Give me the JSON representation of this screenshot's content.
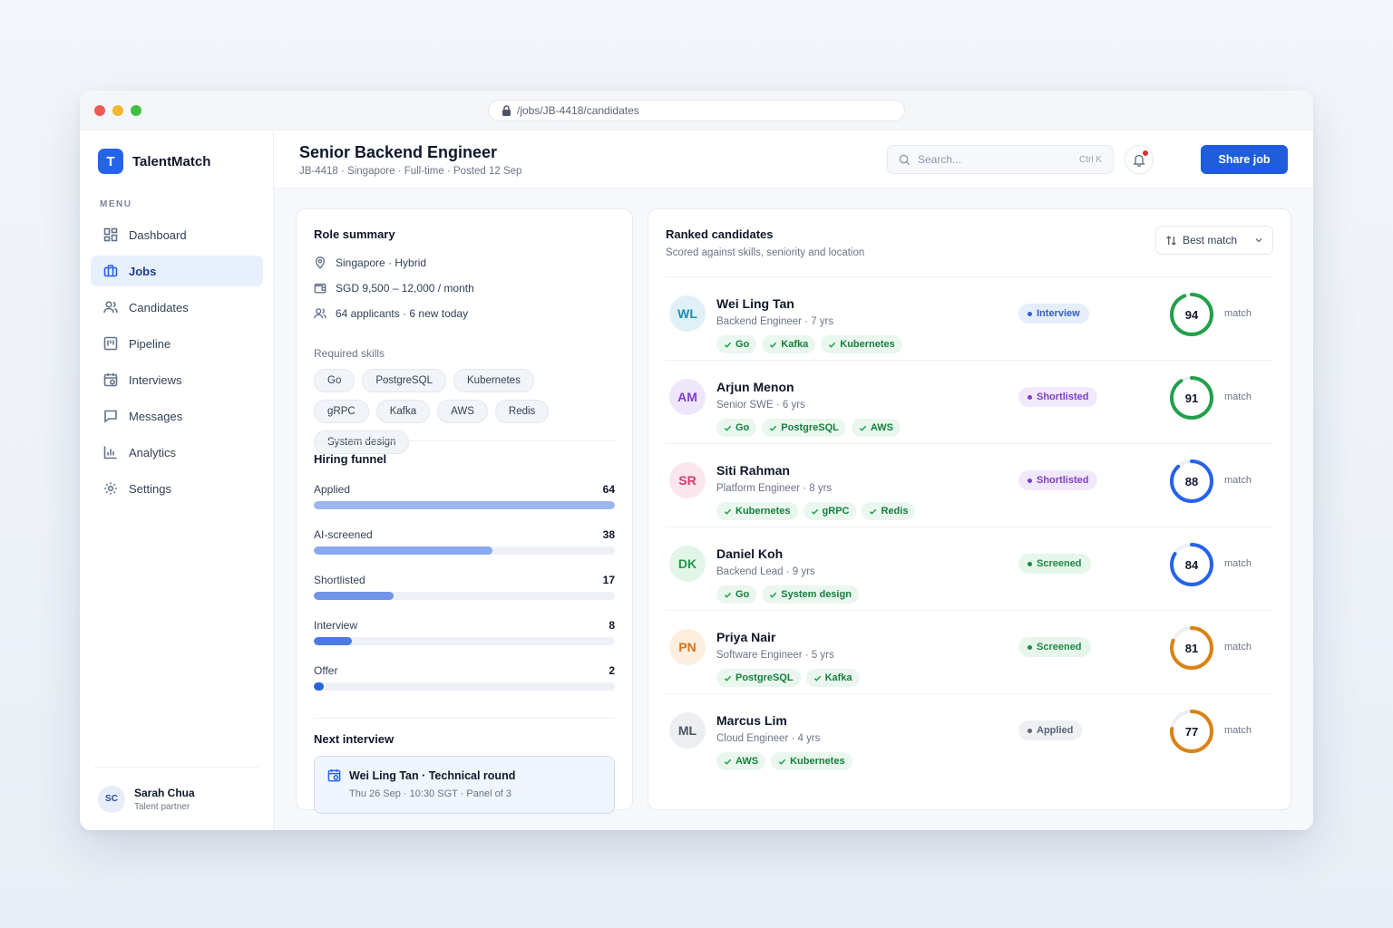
{
  "browser": {
    "url": "/jobs/JB-4418/candidates"
  },
  "brand": {
    "logo_letter": "T",
    "name": "TalentMatch",
    "color": "#2563eb"
  },
  "sidebar": {
    "menu_label": "MENU",
    "items": [
      {
        "label": "Dashboard",
        "icon": "dashboard-icon",
        "active": false
      },
      {
        "label": "Jobs",
        "icon": "briefcase-icon",
        "active": true
      },
      {
        "label": "Candidates",
        "icon": "users-icon",
        "active": false
      },
      {
        "label": "Pipeline",
        "icon": "kanban-icon",
        "active": false
      },
      {
        "label": "Interviews",
        "icon": "calendar-icon",
        "active": false
      },
      {
        "label": "Messages",
        "icon": "chat-icon",
        "active": false
      },
      {
        "label": "Analytics",
        "icon": "bar-chart-icon",
        "active": false
      },
      {
        "label": "Settings",
        "icon": "gear-icon",
        "active": false
      }
    ],
    "user": {
      "initials": "SC",
      "name": "Sarah Chua",
      "role": "Talent partner"
    }
  },
  "header": {
    "title": "Senior Backend Engineer",
    "subtitle": "JB-4418 · Singapore · Full-time · Posted 12 Sep",
    "search_placeholder": "Search...",
    "search_shortcut": "Ctrl K",
    "share_label": "Share job"
  },
  "role_summary": {
    "title": "Role summary",
    "location": "Singapore · Hybrid",
    "salary": "SGD 9,500 – 12,000 / month",
    "applicants": "64 applicants · 6 new today",
    "skills_label": "Required skills",
    "skills": [
      "Go",
      "PostgreSQL",
      "Kubernetes",
      "gRPC",
      "Kafka",
      "AWS",
      "Redis",
      "System design"
    ]
  },
  "funnel": {
    "title": "Hiring funnel",
    "stages": [
      {
        "label": "Applied",
        "count": "64",
        "value": 64,
        "color": "#9db7ee"
      },
      {
        "label": "AI-screened",
        "count": "38",
        "value": 38,
        "color": "#8aa9ec"
      },
      {
        "label": "Shortlisted",
        "count": "17",
        "value": 17,
        "color": "#6f94e8"
      },
      {
        "label": "Interview",
        "count": "8",
        "value": 8,
        "color": "#4b7be3"
      },
      {
        "label": "Offer",
        "count": "2",
        "value": 2,
        "color": "#2a63dc"
      }
    ],
    "max": 64
  },
  "next_interview": {
    "title": "Next interview",
    "heading": "Wei Ling Tan · Technical round",
    "detail": "Thu 26 Sep · 10:30 SGT · Panel of 3"
  },
  "ranked": {
    "title": "Ranked candidates",
    "subtitle": "Scored against skills, seniority and location",
    "sort_label": "Best match",
    "match_label": "match",
    "candidates": [
      {
        "initials": "WL",
        "name": "Wei Ling Tan",
        "role": "Backend Engineer · 7 yrs",
        "skills": [
          "Go",
          "Kafka",
          "Kubernetes"
        ],
        "status": "Interview",
        "score": 94,
        "avatar_bg": "#dff1f7",
        "avatar_fg": "#1a8fb3",
        "status_bg": "#e6eefc",
        "status_fg": "#2e5ec9",
        "ring": "#22a04b"
      },
      {
        "initials": "AM",
        "name": "Arjun Menon",
        "role": "Senior SWE · 6 yrs",
        "skills": [
          "Go",
          "PostgreSQL",
          "AWS"
        ],
        "status": "Shortlisted",
        "score": 91,
        "avatar_bg": "#efe6fb",
        "avatar_fg": "#7b3fc9",
        "status_bg": "#f2e8fc",
        "status_fg": "#7e3fc6",
        "ring": "#22a04b"
      },
      {
        "initials": "SR",
        "name": "Siti Rahman",
        "role": "Platform Engineer · 8 yrs",
        "skills": [
          "Kubernetes",
          "gRPC",
          "Redis"
        ],
        "status": "Shortlisted",
        "score": 88,
        "avatar_bg": "#fbe6ee",
        "avatar_fg": "#d0396e",
        "status_bg": "#f2e8fc",
        "status_fg": "#7e3fc6",
        "ring": "#2563eb"
      },
      {
        "initials": "DK",
        "name": "Daniel Koh",
        "role": "Backend Lead · 9 yrs",
        "skills": [
          "Go",
          "System design"
        ],
        "status": "Screened",
        "score": 84,
        "avatar_bg": "#e3f5e8",
        "avatar_fg": "#1f9a4a",
        "status_bg": "#e6f6ea",
        "status_fg": "#1f8a44",
        "ring": "#2563eb"
      },
      {
        "initials": "PN",
        "name": "Priya Nair",
        "role": "Software Engineer · 5 yrs",
        "skills": [
          "PostgreSQL",
          "Kafka"
        ],
        "status": "Screened",
        "score": 81,
        "avatar_bg": "#fdeede",
        "avatar_fg": "#d9731a",
        "status_bg": "#e6f6ea",
        "status_fg": "#1f8a44",
        "ring": "#d98316"
      },
      {
        "initials": "ML",
        "name": "Marcus Lim",
        "role": "Cloud Engineer · 4 yrs",
        "skills": [
          "AWS",
          "Kubernetes"
        ],
        "status": "Applied",
        "score": 77,
        "avatar_bg": "#eceef2",
        "avatar_fg": "#4b5565",
        "status_bg": "#eef0f3",
        "status_fg": "#5b6577",
        "ring": "#d98316"
      }
    ]
  }
}
